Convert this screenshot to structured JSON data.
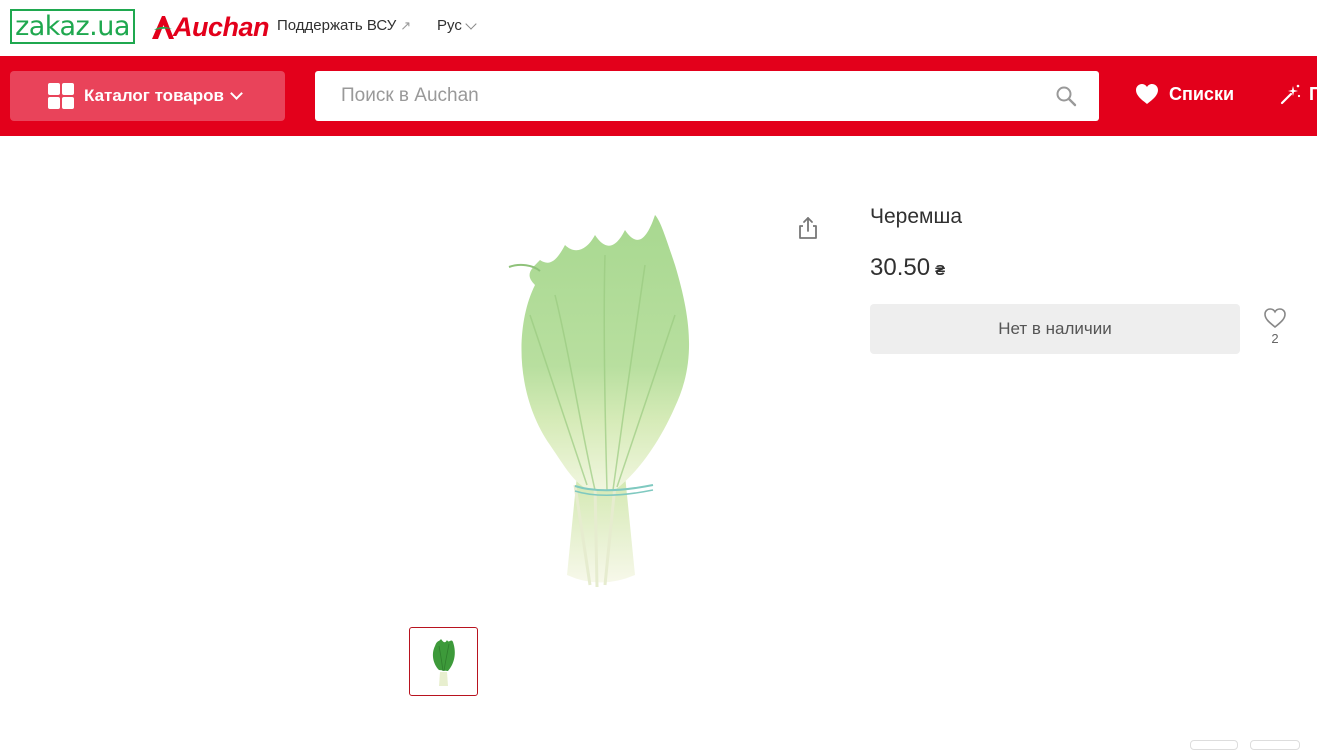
{
  "header": {
    "zakaz_logo": "zakaz.ua",
    "auchan_logo": "Auchan",
    "support_link": "Поддержать ВСУ",
    "support_arrow": "↗",
    "language": "Рус"
  },
  "nav": {
    "catalog_label": "Каталог товаров",
    "search_placeholder": "Поиск в Auchan",
    "lists_label": "Списки",
    "promo_label": "П"
  },
  "product": {
    "title": "Черемша",
    "price": "30.50",
    "currency": "₴",
    "status_button": "Нет в наличии",
    "favorites_count": "2"
  },
  "colors": {
    "brand_red": "#e3001b",
    "catalog_button": "#e9435a",
    "zakaz_green": "#1fa84f",
    "thumb_border": "#b8131f"
  }
}
